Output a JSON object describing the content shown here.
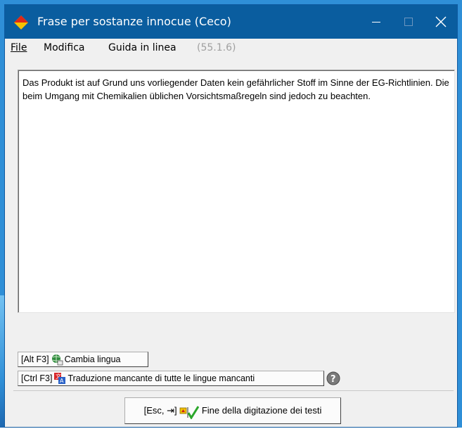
{
  "window": {
    "title": "Frase per sostanze innocue (Ceco)",
    "accent": "#0a5d9f"
  },
  "menu": {
    "file": "File",
    "edit": "Modifica",
    "help": "Guida in linea",
    "version": "(55.1.6)"
  },
  "content": {
    "text": "Das Produkt ist auf Grund uns vorliegender Daten kein gefährlicher Stoff im Sinne der EG-Richtlinien. Die beim Umgang mit Chemikalien üblichen Vorsichtsmaßregeln sind jedoch zu beachten."
  },
  "buttons": {
    "change_language_shortcut": "[Alt F3]",
    "change_language_label": "Cambia lingua",
    "translate_missing_shortcut": "[Ctrl F3]",
    "translate_missing_label": "Traduzione mancante di tutte le lingue mancanti",
    "finish_shortcut": "[Esc, ⇥]",
    "finish_label": "Fine della digitazione dei testi"
  },
  "icons": {
    "app": "diamond-app-icon",
    "change_language": "globe-icon",
    "translate": "translate-icon",
    "help": "help-icon",
    "finish": "checkmark-icon"
  }
}
